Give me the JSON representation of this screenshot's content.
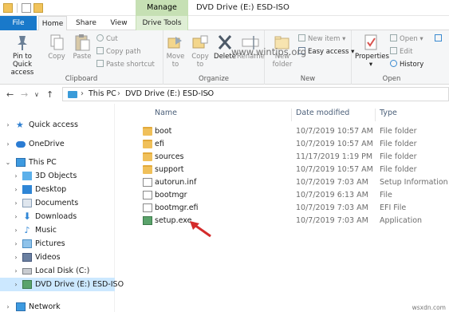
{
  "window": {
    "title": "DVD Drive (E:) ESD-ISO",
    "context_tab": "Manage"
  },
  "tabs": [
    {
      "label": "File"
    },
    {
      "label": "Home"
    },
    {
      "label": "Share"
    },
    {
      "label": "View"
    },
    {
      "label": "Drive Tools"
    }
  ],
  "ribbon": {
    "clipboard": {
      "label": "Clipboard",
      "pin": "Pin to Quick access",
      "copy": "Copy",
      "paste": "Paste",
      "cut": "Cut",
      "copy_path": "Copy path",
      "paste_shortcut": "Paste shortcut"
    },
    "organize": {
      "label": "Organize",
      "move_to": "Move to",
      "copy_to": "Copy to",
      "delete": "Delete",
      "rename": "Rename"
    },
    "new": {
      "label": "New",
      "new_folder": "New folder",
      "new_item": "New item",
      "easy_access": "Easy access"
    },
    "open": {
      "label": "Open",
      "properties": "Properties",
      "open": "Open",
      "edit": "Edit",
      "history": "History"
    }
  },
  "address": {
    "crumbs": [
      "This PC",
      "DVD Drive (E:) ESD-ISO"
    ]
  },
  "nav": [
    {
      "label": "Quick access",
      "icon": "star-icon"
    },
    {
      "label": "OneDrive",
      "icon": "cloud-icon"
    },
    {
      "label": "This PC",
      "icon": "computer-icon"
    },
    {
      "label": "3D Objects",
      "icon": "cube-icon"
    },
    {
      "label": "Desktop",
      "icon": "desktop-icon"
    },
    {
      "label": "Documents",
      "icon": "documents-icon"
    },
    {
      "label": "Downloads",
      "icon": "download-icon"
    },
    {
      "label": "Music",
      "icon": "music-icon"
    },
    {
      "label": "Pictures",
      "icon": "pictures-icon"
    },
    {
      "label": "Videos",
      "icon": "videos-icon"
    },
    {
      "label": "Local Disk (C:)",
      "icon": "disk-icon"
    },
    {
      "label": "DVD Drive (E:) ESD-ISO",
      "icon": "dvd-icon"
    },
    {
      "label": "Network",
      "icon": "network-icon"
    }
  ],
  "columns": {
    "name": "Name",
    "date": "Date modified",
    "type": "Type"
  },
  "files": [
    {
      "name": "boot",
      "date": "10/7/2019 10:57 AM",
      "type": "File folder",
      "icon": "folder-icon"
    },
    {
      "name": "efi",
      "date": "10/7/2019 10:57 AM",
      "type": "File folder",
      "icon": "folder-icon"
    },
    {
      "name": "sources",
      "date": "11/17/2019 1:19 PM",
      "type": "File folder",
      "icon": "folder-icon"
    },
    {
      "name": "support",
      "date": "10/7/2019 10:57 AM",
      "type": "File folder",
      "icon": "folder-icon"
    },
    {
      "name": "autorun.inf",
      "date": "10/7/2019 7:03 AM",
      "type": "Setup Information",
      "icon": "settings-file-icon"
    },
    {
      "name": "bootmgr",
      "date": "10/7/2019 6:13 AM",
      "type": "File",
      "icon": "file-icon"
    },
    {
      "name": "bootmgr.efi",
      "date": "10/7/2019 7:03 AM",
      "type": "EFI File",
      "icon": "file-icon"
    },
    {
      "name": "setup.exe",
      "date": "10/7/2019 7:03 AM",
      "type": "Application",
      "icon": "setup-exe-icon"
    }
  ],
  "watermark": "www.wintips.org",
  "corner_watermark": "wsxdn.com"
}
